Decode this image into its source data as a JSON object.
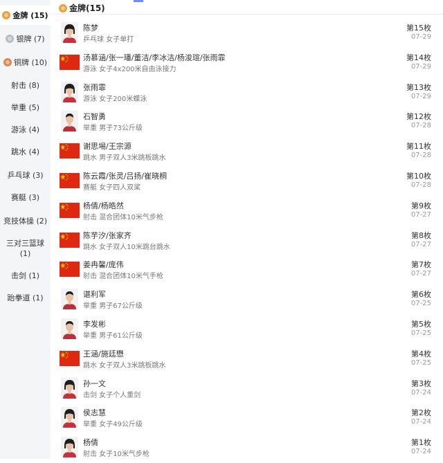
{
  "sidebar": {
    "items": [
      {
        "label": "金牌 (15)",
        "medal": "gold",
        "active": true
      },
      {
        "label": "银牌 (7)",
        "medal": "silver"
      },
      {
        "label": "铜牌 (10)",
        "medal": "bronze"
      },
      {
        "label": "射击 (8)"
      },
      {
        "label": "举重 (5)"
      },
      {
        "label": "游泳 (4)"
      },
      {
        "label": "跳水 (4)"
      },
      {
        "label": "乒乓球 (3)"
      },
      {
        "label": "赛艇 (3)"
      },
      {
        "label": "竞技体操 (2)"
      },
      {
        "label": "三对三篮球 (1)"
      },
      {
        "label": "击剑 (1)"
      },
      {
        "label": "跆拳道 (1)"
      }
    ]
  },
  "header": {
    "title": "金牌(15)",
    "medal": "gold"
  },
  "medals": [
    {
      "name": "陈梦",
      "detail": "乒乓球 女子单打",
      "rank": "第15枚",
      "date": "07-29",
      "avatar": "portrait-female"
    },
    {
      "name": "汤慕涵/张一璠/董洁/李冰洁/杨浚瑄/张雨霏",
      "detail": "游泳 女子4x200米自由泳接力",
      "rank": "第14枚",
      "date": "07-29",
      "avatar": "flag"
    },
    {
      "name": "张雨霏",
      "detail": "游泳 女子200米蝶泳",
      "rank": "第13枚",
      "date": "07-29",
      "avatar": "portrait-female"
    },
    {
      "name": "石智勇",
      "detail": "举重 男子73公斤级",
      "rank": "第12枚",
      "date": "07-28",
      "avatar": "portrait-male"
    },
    {
      "name": "谢思埸/王宗源",
      "detail": "跳水 男子双人3米跳板跳水",
      "rank": "第11枚",
      "date": "07-28",
      "avatar": "flag"
    },
    {
      "name": "陈云霞/张灵/吕扬/崔晓桐",
      "detail": "赛艇 女子四人双桨",
      "rank": "第10枚",
      "date": "07-28",
      "avatar": "flag"
    },
    {
      "name": "杨倩/杨皓然",
      "detail": "射击 混合团体10米气步枪",
      "rank": "第9枚",
      "date": "07-27",
      "avatar": "flag"
    },
    {
      "name": "陈芋汐/张家齐",
      "detail": "跳水 女子双人10米跳台跳水",
      "rank": "第8枚",
      "date": "07-27",
      "avatar": "flag"
    },
    {
      "name": "姜冉馨/庞伟",
      "detail": "射击 混合团体10米气手枪",
      "rank": "第7枚",
      "date": "07-27",
      "avatar": "flag"
    },
    {
      "name": "谌利军",
      "detail": "举重 男子67公斤级",
      "rank": "第6枚",
      "date": "07-25",
      "avatar": "portrait-male"
    },
    {
      "name": "李发彬",
      "detail": "举重 男子61公斤级",
      "rank": "第5枚",
      "date": "07-25",
      "avatar": "portrait-male"
    },
    {
      "name": "王涵/施廷懋",
      "detail": "跳水 女子双人3米跳板跳水",
      "rank": "第4枚",
      "date": "07-25",
      "avatar": "flag"
    },
    {
      "name": "孙一文",
      "detail": "击剑 女子个人重剑",
      "rank": "第3枚",
      "date": "07-24",
      "avatar": "portrait-female"
    },
    {
      "name": "侯志慧",
      "detail": "举重 女子49公斤级",
      "rank": "第2枚",
      "date": "07-24",
      "avatar": "portrait-female"
    },
    {
      "name": "杨倩",
      "detail": "射击 女子10米气步枪",
      "rank": "第1枚",
      "date": "07-24",
      "avatar": "portrait-female"
    }
  ],
  "colors": {
    "flag_red": "#de2910",
    "flag_star": "#ffde00",
    "gold": "#e9a23b",
    "silver": "#b8bcc4",
    "bronze": "#d98a55",
    "sidebar_bg": "#f4f5f7"
  }
}
